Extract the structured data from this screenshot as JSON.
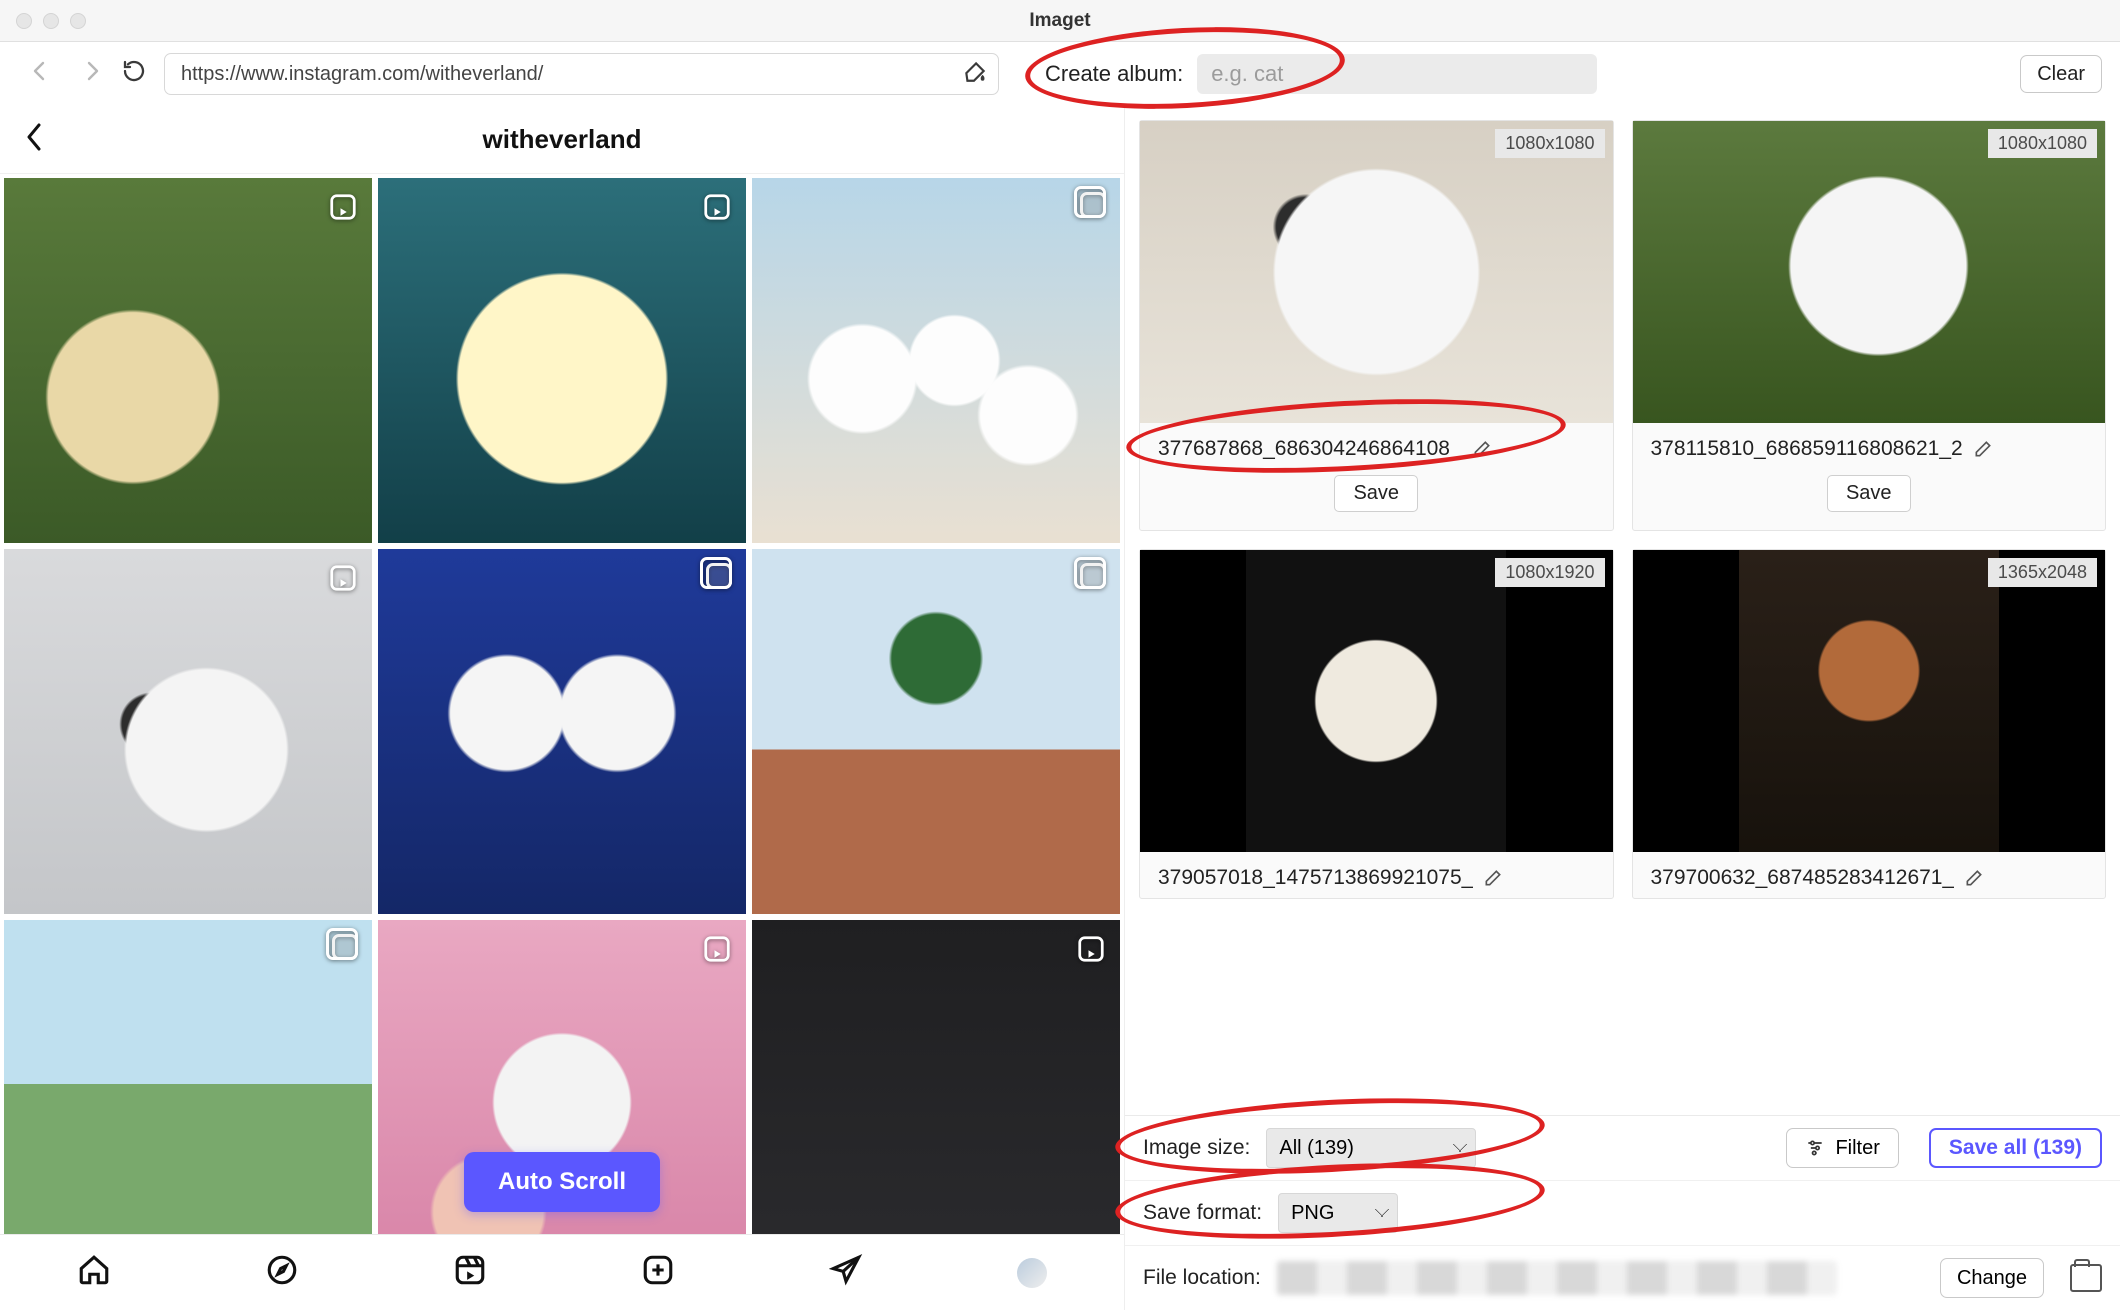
{
  "window": {
    "title": "Imaget"
  },
  "toolbar": {
    "url": "https://www.instagram.com/witheverland/",
    "create_album_label": "Create album:",
    "album_placeholder": "e.g. cat",
    "clear_label": "Clear"
  },
  "profile": {
    "username": "witheverland"
  },
  "ig_grid": {
    "tiles": [
      {
        "type": "reel"
      },
      {
        "type": "reel"
      },
      {
        "type": "carousel"
      },
      {
        "type": "reel"
      },
      {
        "type": "carousel"
      },
      {
        "type": "carousel"
      },
      {
        "type": "carousel"
      },
      {
        "type": "reel"
      },
      {
        "type": "reel"
      }
    ],
    "auto_scroll_label": "Auto Scroll"
  },
  "ig_nav": {
    "items": [
      "home",
      "explore",
      "reels",
      "create",
      "messages",
      "profile"
    ]
  },
  "cards": [
    {
      "dimensions": "1080x1080",
      "filename": "377687868_686304246864108_",
      "save_label": "Save"
    },
    {
      "dimensions": "1080x1080",
      "filename": "378115810_686859116808621_2",
      "save_label": "Save"
    },
    {
      "dimensions": "1080x1920",
      "filename": "379057018_1475713869921075_"
    },
    {
      "dimensions": "1365x2048",
      "filename": "379700632_687485283412671_"
    }
  ],
  "controls": {
    "image_size_label": "Image size:",
    "image_size_value": "All (139)",
    "filter_label": "Filter",
    "save_all_label": "Save all (139)",
    "save_format_label": "Save format:",
    "save_format_value": "PNG",
    "file_location_label": "File location:",
    "change_label": "Change"
  }
}
